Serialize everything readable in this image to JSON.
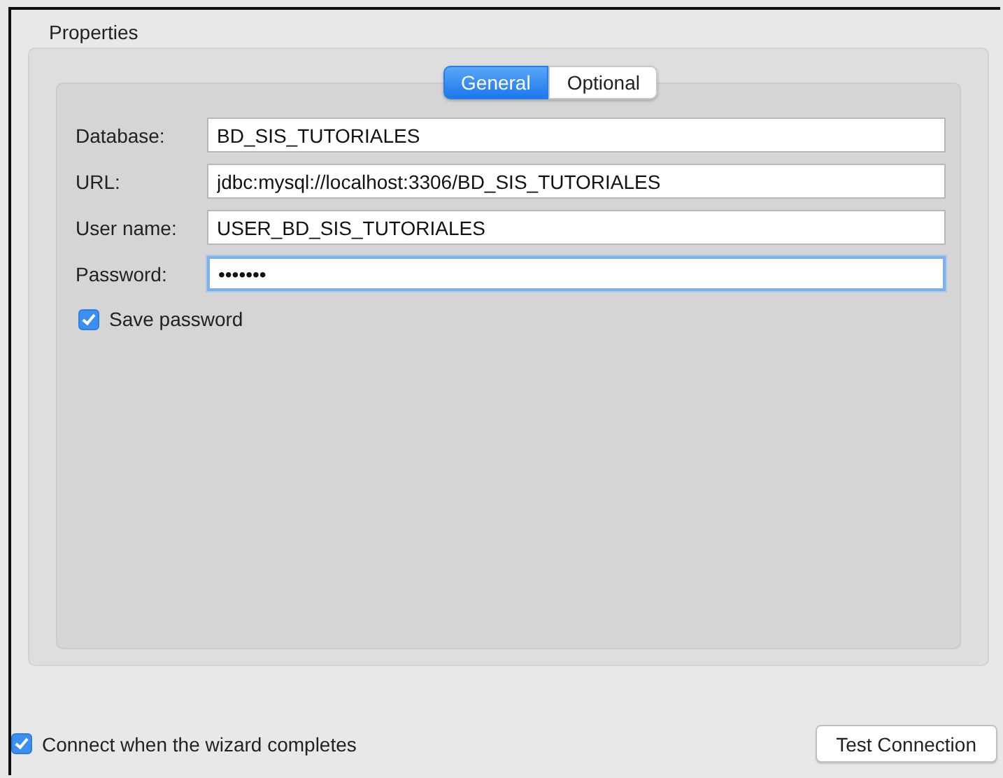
{
  "group": {
    "title": "Properties"
  },
  "tabs": [
    {
      "label": "General",
      "selected": true
    },
    {
      "label": "Optional",
      "selected": false
    }
  ],
  "fields": [
    {
      "label": "Database:",
      "value": "BD_SIS_TUTORIALES",
      "focused": false
    },
    {
      "label": "URL:",
      "value": "jdbc:mysql://localhost:3306/BD_SIS_TUTORIALES",
      "focused": false
    },
    {
      "label": "User name:",
      "value": "USER_BD_SIS_TUTORIALES",
      "focused": false
    },
    {
      "label": "Password:",
      "value": "•••••••",
      "focused": true
    }
  ],
  "save_password": {
    "label": "Save password",
    "checked": true
  },
  "connect_on_finish": {
    "label": "Connect when the wizard completes",
    "checked": true
  },
  "buttons": [
    {
      "label": "Test Connection"
    }
  ]
}
